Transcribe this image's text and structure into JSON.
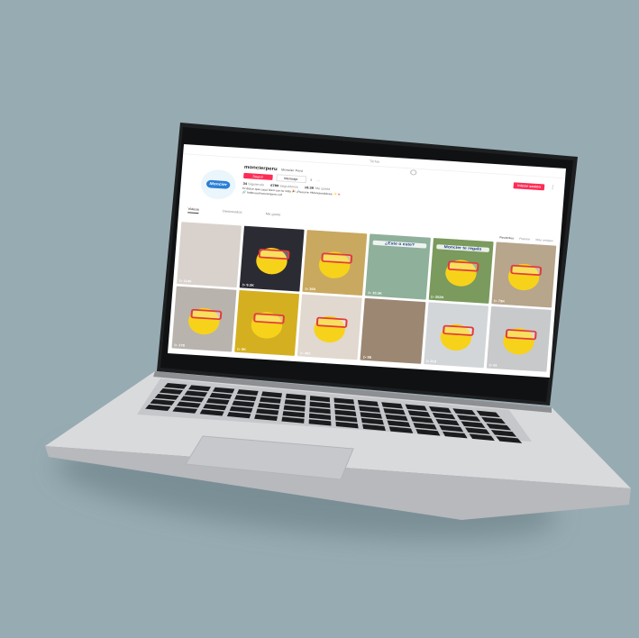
{
  "browser": {
    "site": "TikTok"
  },
  "header": {
    "login_label": "Iniciar sesión",
    "more": "⋮"
  },
  "profile": {
    "username": "moncierperu",
    "nickname": "Moncier Perú",
    "follow_label": "Seguir",
    "message_label": "Mensaje",
    "share_icon": "share-icon",
    "more_label": "···",
    "avatar_text": "Moncier",
    "stats": [
      {
        "value": "34",
        "label": "Siguiendo"
      },
      {
        "value": "6789",
        "label": "Seguidores"
      },
      {
        "value": "19.3K",
        "label": "Me gusta"
      }
    ],
    "bio": "El dulce que cayó bien con tu vida 🎉 ¡Recorre #Moncierdulces ✨🍬",
    "link": "🔗 linktr.ee/moncierperu.cof"
  },
  "tabs": [
    {
      "label": "Videos",
      "active": true
    },
    {
      "label": "Destacados",
      "active": false
    },
    {
      "label": "Me gusta",
      "active": false
    }
  ],
  "sort": [
    {
      "label": "Recientes",
      "active": true
    },
    {
      "label": "Popular",
      "active": false
    },
    {
      "label": "Más antiguo",
      "active": false
    }
  ],
  "videos": [
    {
      "views": "▷ 1145",
      "bg": "#d9d2cc",
      "mascot": false,
      "caption": ""
    },
    {
      "views": "▷ 9.2K",
      "bg": "#2b2b33",
      "mascot": true,
      "caption": ""
    },
    {
      "views": "▷ 360",
      "bg": "#c9a960",
      "mascot": true,
      "caption": ""
    },
    {
      "views": "▷ 10.3K",
      "bg": "#8fb09a",
      "mascot": false,
      "caption": "¿Este o este?"
    },
    {
      "views": "▷ 202K",
      "bg": "#7a9a5e",
      "mascot": true,
      "caption": "Moncier te regala"
    },
    {
      "views": "▷ 73K",
      "bg": "#b7a58c",
      "mascot": true,
      "caption": ""
    },
    {
      "views": "▷ 178",
      "bg": "#b9b3ad",
      "mascot": true,
      "caption": ""
    },
    {
      "views": "▷ 5K",
      "bg": "#d4b021",
      "mascot": true,
      "caption": ""
    },
    {
      "views": "▷ 462",
      "bg": "#e1d8cf",
      "mascot": true,
      "caption": ""
    },
    {
      "views": "▷ 98",
      "bg": "#9c8773",
      "mascot": false,
      "caption": ""
    },
    {
      "views": "▷ 213",
      "bg": "#d3d6d9",
      "mascot": true,
      "caption": ""
    },
    {
      "views": "▷ 61",
      "bg": "#c7c9cb",
      "mascot": true,
      "caption": ""
    }
  ]
}
